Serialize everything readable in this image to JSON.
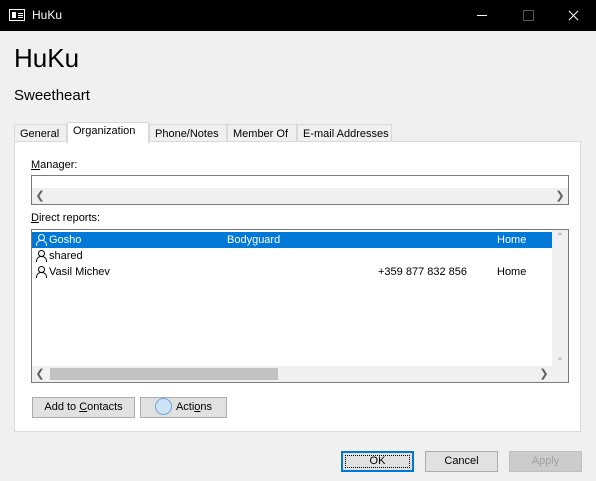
{
  "window": {
    "title": "HuKu"
  },
  "contact": {
    "name": "HuKu",
    "subtitle": "Sweetheart"
  },
  "tabs": [
    {
      "label": "General"
    },
    {
      "label": "Organization"
    },
    {
      "label": "Phone/Notes"
    },
    {
      "label": "Member Of"
    },
    {
      "label": "E-mail Addresses"
    }
  ],
  "active_tab": "Organization",
  "manager": {
    "label_u": "M",
    "label_rest": "anager:",
    "value": ""
  },
  "direct_reports": {
    "label_u": "D",
    "label_rest": "irect reports:",
    "rows": [
      {
        "name": "Gosho",
        "title": "Bodyguard",
        "phone": "",
        "location": "Home",
        "selected": true
      },
      {
        "name": "shared",
        "title": "",
        "phone": "",
        "location": "",
        "selected": false
      },
      {
        "name": "Vasil Michev",
        "title": "",
        "phone": "+359 877 832 856",
        "location": "Home",
        "selected": false
      }
    ]
  },
  "buttons": {
    "add_to_contacts_pre": "Add to ",
    "add_to_contacts_u": "C",
    "add_to_contacts_post": "ontacts",
    "actions_pre": "Acti",
    "actions_u": "o",
    "actions_post": "ns",
    "ok": "OK",
    "cancel": "Cancel",
    "apply": "Apply"
  },
  "colors": {
    "selection": "#0078d7",
    "titlebar": "#000000",
    "accent": "#0078d7"
  }
}
